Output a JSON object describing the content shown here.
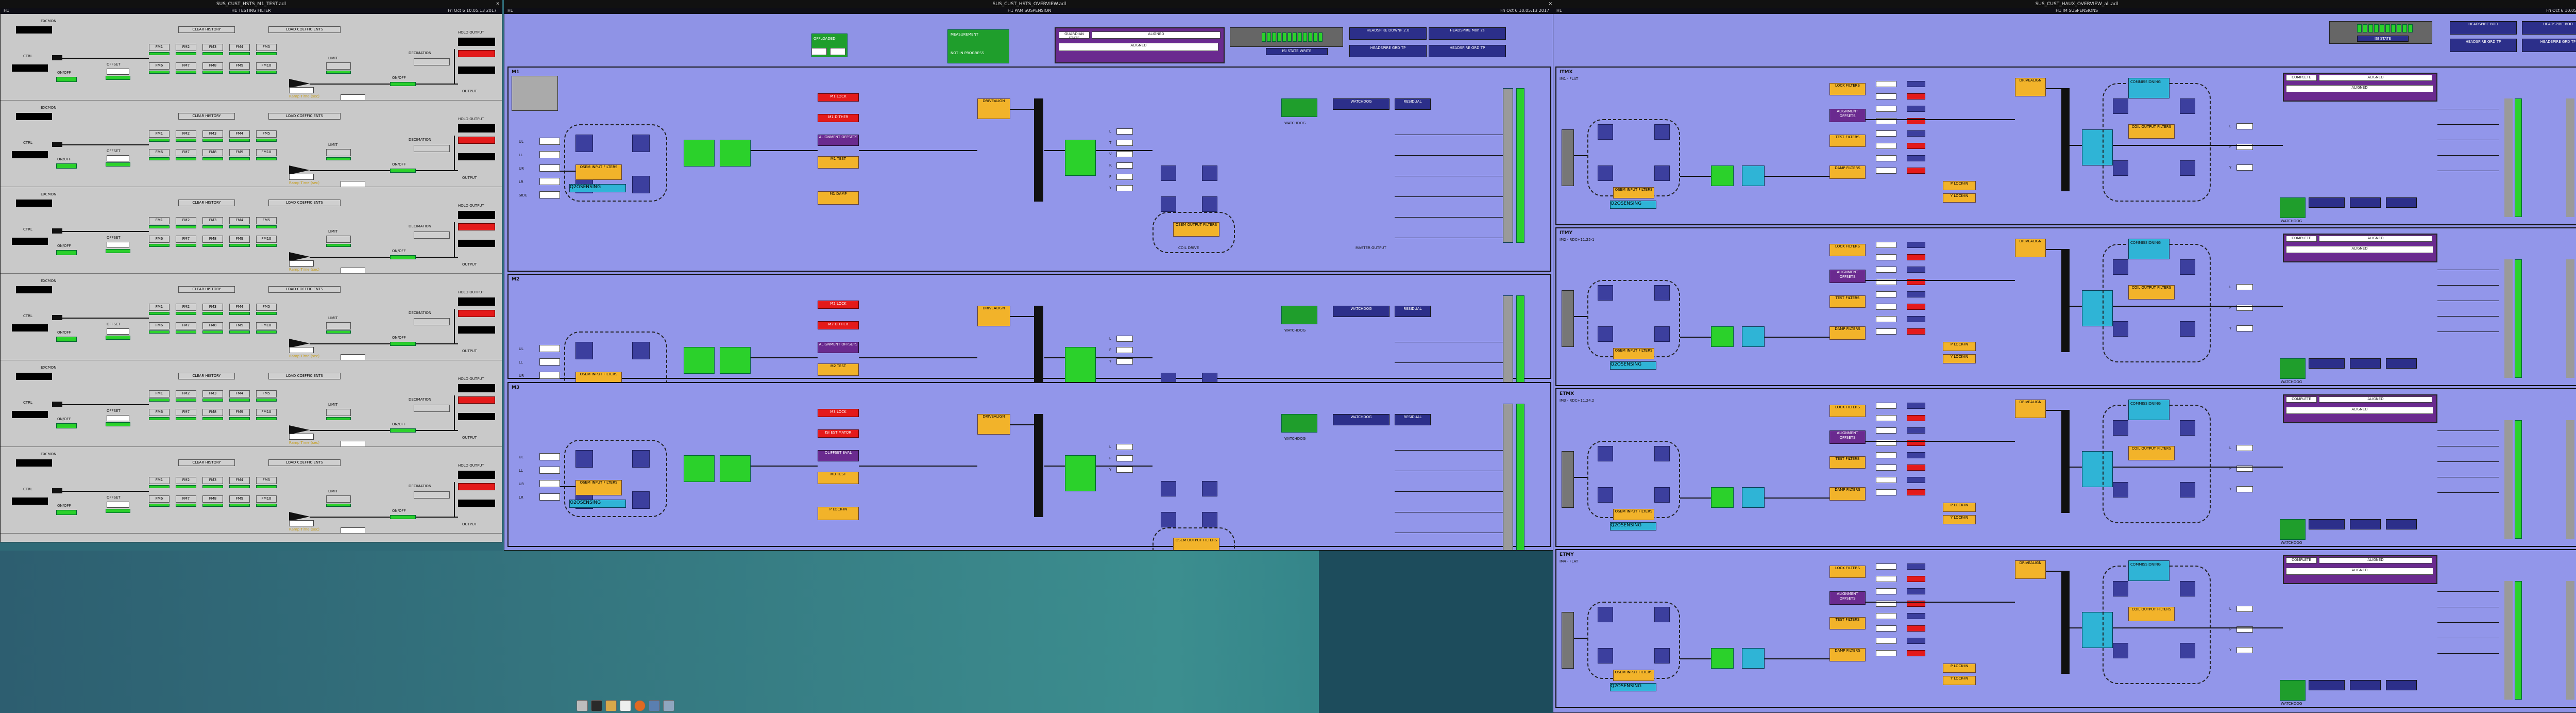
{
  "desktop": {
    "taskbar_items": [
      "files",
      "terminal",
      "folder",
      "editor",
      "browser",
      "network",
      "settings"
    ]
  },
  "win1": {
    "title": "SUS_CUST_HSTS_M1_TEST.adl",
    "menu_left": "H1",
    "menu_center": "H1 TESTING FILTER",
    "menu_right": "Fri Oct 6 10:05:13 2017",
    "rows": [
      {
        "label": "EXCMON",
        "ctl": "CTRL",
        "offset": "OFFSET",
        "limit": "LIMIT",
        "onoff": "ON/OFF",
        "decim": "DECIMATION",
        "hold": "HOLD OUTPUT",
        "out": "OUTPUT",
        "ramp": "Ramp Time (sec)",
        "clear": "CLEAR HISTORY",
        "load": "LOAD COEFFICIENTS",
        "fm": [
          "FM1",
          "FM2",
          "FM3",
          "FM4",
          "FM5",
          "FM6",
          "FM7",
          "FM8",
          "FM9",
          "FM10"
        ]
      },
      {
        "label": "EXCMON",
        "ctl": "CTRL",
        "offset": "OFFSET",
        "limit": "LIMIT",
        "onoff": "ON/OFF",
        "decim": "DECIMATION",
        "hold": "HOLD OUTPUT",
        "out": "OUTPUT",
        "ramp": "Ramp Time (sec)",
        "clear": "CLEAR HISTORY",
        "load": "LOAD COEFFICIENTS",
        "fm": [
          "FM1",
          "FM2",
          "FM3",
          "FM4",
          "FM5",
          "FM6",
          "FM7",
          "FM8",
          "FM9",
          "FM10"
        ]
      },
      {
        "label": "EXCMON",
        "ctl": "CTRL",
        "offset": "OFFSET",
        "limit": "LIMIT",
        "onoff": "ON/OFF",
        "decim": "DECIMATION",
        "hold": "HOLD OUTPUT",
        "out": "OUTPUT",
        "ramp": "Ramp Time (sec)",
        "clear": "CLEAR HISTORY",
        "load": "LOAD COEFFICIENTS",
        "fm": [
          "FM1",
          "FM2",
          "FM3",
          "FM4",
          "FM5",
          "FM6",
          "FM7",
          "FM8",
          "FM9",
          "FM10"
        ]
      },
      {
        "label": "EXCMON",
        "ctl": "CTRL",
        "offset": "OFFSET",
        "limit": "LIMIT",
        "onoff": "ON/OFF",
        "decim": "DECIMATION",
        "hold": "HOLD OUTPUT",
        "out": "OUTPUT",
        "ramp": "Ramp Time (sec)",
        "clear": "CLEAR HISTORY",
        "load": "LOAD COEFFICIENTS",
        "fm": [
          "FM1",
          "FM2",
          "FM3",
          "FM4",
          "FM5",
          "FM6",
          "FM7",
          "FM8",
          "FM9",
          "FM10"
        ]
      },
      {
        "label": "EXCMON",
        "ctl": "CTRL",
        "offset": "OFFSET",
        "limit": "LIMIT",
        "onoff": "ON/OFF",
        "decim": "DECIMATION",
        "hold": "HOLD OUTPUT",
        "out": "OUTPUT",
        "ramp": "Ramp Time (sec)",
        "clear": "CLEAR HISTORY",
        "load": "LOAD COEFFICIENTS",
        "fm": [
          "FM1",
          "FM2",
          "FM3",
          "FM4",
          "FM5",
          "FM6",
          "FM7",
          "FM8",
          "FM9",
          "FM10"
        ]
      },
      {
        "label": "EXCMON",
        "ctl": "CTRL",
        "offset": "OFFSET",
        "limit": "LIMIT",
        "onoff": "ON/OFF",
        "decim": "DECIMATION",
        "hold": "HOLD OUTPUT",
        "out": "OUTPUT",
        "ramp": "Ramp Time (sec)",
        "clear": "CLEAR HISTORY",
        "load": "LOAD COEFFICIENTS",
        "fm": [
          "FM1",
          "FM2",
          "FM3",
          "FM4",
          "FM5",
          "FM6",
          "FM7",
          "FM8",
          "FM9",
          "FM10"
        ]
      }
    ]
  },
  "win2": {
    "title": "SUS_CUST_HSTS_OVERVIEW.adl",
    "menu_left": "H1",
    "menu_center": "H1 PAM SUSPENSION",
    "menu_right": "Fri Oct 6 10:05:13 2017",
    "top": {
      "offload": "OFFLOADED",
      "guardian_box": "GUARDIAN STATE",
      "aligned": "ALIGNED",
      "aligned2": "ALIGNED",
      "measurement": "MEASUREMENT",
      "noise": "NOT IN PROGRESS",
      "commissioning": "COMMISSIONING",
      "watchdog": "WATCHDOG",
      "wd_reset": "HEADSPIRE DOWNF 2.0",
      "wd_reset2": "HEADSPIRE Mon 2s",
      "sw_state": "ISI STATE WRITE",
      "sw1": "HEADSPIRE GRD TP",
      "sw2": "HEADSPIRE GRD TP"
    },
    "stages": [
      {
        "name": "M1",
        "inputs": [
          "UL",
          "LL",
          "UR",
          "LR",
          "SIDE"
        ],
        "osem": "OSEM INPUT FILTERS",
        "qosem": "Q2OSENSING",
        "lock": "M1 LOCK",
        "drive": "M1 DITHER",
        "align": "ALIGNMENT OFFSETS",
        "test": "M1 TEST",
        "damp": "M1 DAMP",
        "output": "OSEM OUTPUT FILTERS",
        "drivealign": "DRIVEALIGN",
        "wd": "WATCHDOG",
        "ctrl": "COIL DRIVE",
        "master": "MASTER OUTPUT",
        "dofs": [
          "L",
          "T",
          "V",
          "R",
          "P",
          "Y"
        ]
      },
      {
        "name": "M2",
        "inputs": [
          "UL",
          "LL",
          "UR",
          "LR"
        ],
        "osem": "OSEM INPUT FILTERS",
        "qosem": "Q2OSENSING",
        "lock": "M2 LOCK",
        "drive": "M2 DITHER",
        "align": "ALIGNMENT OFFSETS",
        "test": "M2 TEST",
        "damp": "M2 DAMP",
        "output": "OSEM OUTPUT FILTERS",
        "drivealign": "DRIVEALIGN",
        "wd": "WATCHDOG",
        "ctrl": "COIL DRIVE",
        "master": "MASTER OUTPUT",
        "dofs": [
          "L",
          "P",
          "Y"
        ]
      },
      {
        "name": "M3",
        "inputs": [
          "UL",
          "LL",
          "UR",
          "LR"
        ],
        "osem": "OSEM INPUT FILTERS",
        "qosem": "Q2OSENSING",
        "lock": "M3 LOCK",
        "drive": "ISI ESTIMATOR",
        "align": "OLIFFSET EVAL",
        "test": "M3 TEST",
        "damp": "P LOCK-IN",
        "output": "OSEM OUTPUT FILTERS",
        "drivealign": "DRIVEALIGN",
        "wd": "WATCHDOG",
        "ctrl": "COIL DRIVE",
        "master": "MASTER OUTPUT",
        "dofs": [
          "L",
          "P",
          "Y"
        ]
      }
    ],
    "damp_status": [
      "WATCHDOG",
      "RESIDUAL",
      "SENSOR"
    ]
  },
  "win3": {
    "title": "SUS_CUST_HAUX_OVERVIEW_all.adl",
    "menu_left": "H1",
    "menu_center": "H1 IM SUSPENSIONS",
    "menu_right": "Fri Oct 6 10:05:13 2017",
    "top": {
      "state": "ISI STATE",
      "btn1": "HEADSPIRE BOD",
      "btn2": "HEADSPIRE BOD",
      "sw1": "HEADSPIRE GRD TP",
      "sw2": "HEADSPIRE GRD TP"
    },
    "optics": [
      {
        "name": "ITMX",
        "title": "COMPLETE",
        "stage": "IM1 - FLAT",
        "guardian": "ALIGNED",
        "commissioning": "COMMISSIONING",
        "lock": "LOCK FILTERS",
        "align": "ALIGNMENT OFFSETS",
        "test": "TEST FILTERS",
        "damp": "DAMP FILTERS",
        "osem": "OSEM INPUT FILTERS",
        "qosem": "Q2OSENSING",
        "output": "COIL OUTPUT FILTERS",
        "drivealign": "DRIVEALIGN",
        "wd": "WATCHDOG",
        "plock": "P LOCK-IN",
        "ylock": "Y LOCK-IN",
        "dofs": [
          "L",
          "P",
          "Y"
        ]
      },
      {
        "name": "ITMY",
        "title": "COMPLETE",
        "stage": "IM2 - RDC+11.25-1",
        "guardian": "ALIGNED",
        "commissioning": "COMMISSIONING",
        "lock": "LOCK FILTERS",
        "align": "ALIGNMENT OFFSETS",
        "test": "TEST FILTERS",
        "damp": "DAMP FILTERS",
        "osem": "OSEM INPUT FILTERS",
        "qosem": "Q2OSENSING",
        "output": "COIL OUTPUT FILTERS",
        "drivealign": "DRIVEALIGN",
        "wd": "WATCHDOG",
        "plock": "P LOCK-IN",
        "ylock": "Y LOCK-IN",
        "dofs": [
          "L",
          "P",
          "Y"
        ]
      },
      {
        "name": "ETMX",
        "title": "COMPLETE",
        "stage": "IM3 - RDC+11.24.2",
        "guardian": "ALIGNED",
        "commissioning": "COMMISSIONING",
        "lock": "LOCK FILTERS",
        "align": "ALIGNMENT OFFSETS",
        "test": "TEST FILTERS",
        "damp": "DAMP FILTERS",
        "osem": "OSEM INPUT FILTERS",
        "qosem": "Q2OSENSING",
        "output": "COIL OUTPUT FILTERS",
        "drivealign": "DRIVEALIGN",
        "wd": "WATCHDOG",
        "plock": "P LOCK-IN",
        "ylock": "Y LOCK-IN",
        "dofs": [
          "L",
          "P",
          "Y"
        ]
      },
      {
        "name": "ETMY",
        "title": "COMPLETE",
        "stage": "IM4 - FLAT",
        "guardian": "ALIGNED",
        "commissioning": "COMMISSIONING",
        "lock": "LOCK FILTERS",
        "align": "ALIGNMENT OFFSETS",
        "test": "TEST FILTERS",
        "damp": "DAMP FILTERS",
        "osem": "OSEM INPUT FILTERS",
        "qosem": "Q2OSENSING",
        "output": "COIL OUTPUT FILTERS",
        "drivealign": "DRIVEALIGN",
        "wd": "WATCHDOG",
        "plock": "P LOCK-IN",
        "ylock": "Y LOCK-IN",
        "dofs": [
          "L",
          "P",
          "Y"
        ]
      }
    ]
  },
  "colors": {
    "panel_gray": "#c9c9c9",
    "panel_lavender": "#8f93e6",
    "green": "#2bd12b",
    "red": "#e41a1a",
    "yellow": "#f2b32a",
    "purple": "#6a2a8f",
    "pink": "#d97bd9",
    "navy": "#3c3f9e",
    "cyan": "#2fb4d6"
  }
}
